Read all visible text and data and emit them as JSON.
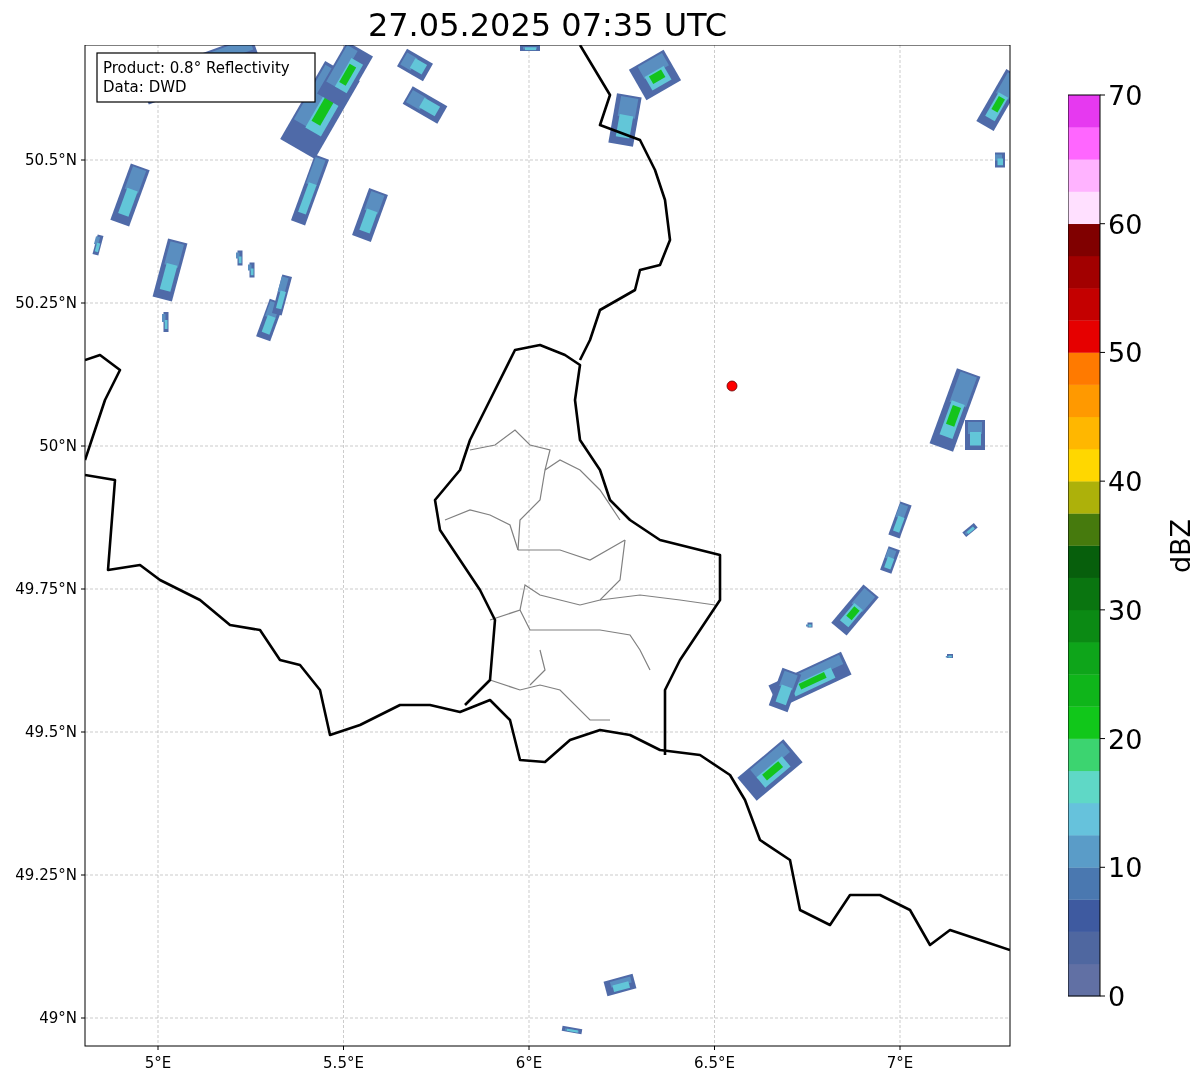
{
  "title": "27.05.2025 07:35 UTC",
  "info_box": [
    "Product: 0.8° Reflectivity",
    "Data: DWD"
  ],
  "map": {
    "x_ticks": [
      "5°E",
      "5.5°E",
      "6°E",
      "6.5°E",
      "7°E"
    ],
    "y_ticks": [
      "50.5°N",
      "50.25°N",
      "50°N",
      "49.75°N",
      "49.5°N",
      "49.25°N",
      "49°N"
    ]
  },
  "colorbar": {
    "label": "dBZ",
    "ticks": [
      "70",
      "60",
      "50",
      "40",
      "30",
      "20",
      "10",
      "0"
    ],
    "bands": [
      {
        "color": "#6170a4"
      },
      {
        "color": "#4f67a0"
      },
      {
        "color": "#3e5aa0"
      },
      {
        "color": "#4a78b0"
      },
      {
        "color": "#5a9cc8"
      },
      {
        "color": "#66c2dc"
      },
      {
        "color": "#5fd8c6"
      },
      {
        "color": "#3cd470"
      },
      {
        "color": "#11c71a"
      },
      {
        "color": "#0fb51a"
      },
      {
        "color": "#0ea51a"
      },
      {
        "color": "#0b8a14"
      },
      {
        "color": "#0a7510"
      },
      {
        "color": "#075f0c"
      },
      {
        "color": "#467a0d"
      },
      {
        "color": "#adb10a"
      },
      {
        "color": "#ffd700"
      },
      {
        "color": "#ffb700"
      },
      {
        "color": "#ff9900"
      },
      {
        "color": "#ff7a00"
      },
      {
        "color": "#e60000"
      },
      {
        "color": "#c40000"
      },
      {
        "color": "#a20000"
      },
      {
        "color": "#800000"
      },
      {
        "color": "#ffe0ff"
      },
      {
        "color": "#ffb3ff"
      },
      {
        "color": "#ff66ff"
      },
      {
        "color": "#e639f0"
      }
    ]
  }
}
